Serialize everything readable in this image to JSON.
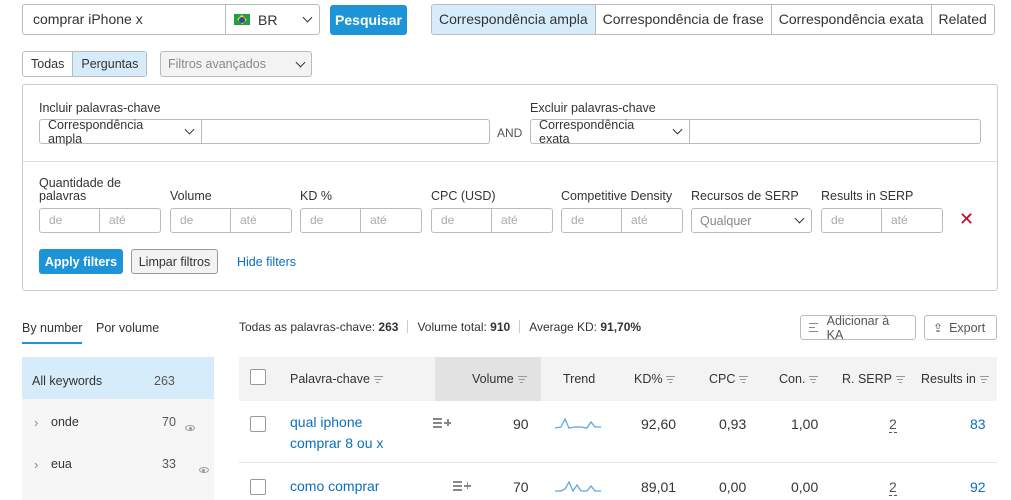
{
  "search": {
    "query": "comprar iPhone x",
    "database": "BR",
    "button": "Pesquisar"
  },
  "match_tabs": [
    "Correspondência ampla",
    "Correspondência de frase",
    "Correspondência exata",
    "Related"
  ],
  "question_tabs": {
    "all": "Todas",
    "questions": "Perguntas",
    "advanced": "Filtros avançados"
  },
  "filters": {
    "include_label": "Incluir palavras-chave",
    "include_match": "Correspondência ampla",
    "and_label": "AND",
    "exclude_label": "Excluir palavras-chave",
    "exclude_match": "Correspondência exata",
    "word_count_label_1": "Quantidade de",
    "word_count_label_2": "palavras",
    "volume_label": "Volume",
    "kd_label": "KD %",
    "cpc_label": "CPC (USD)",
    "density_label": "Competitive Density",
    "serp_features_label": "Recursos de SERP",
    "results_label": "Results in SERP",
    "from_ph": "de",
    "to_ph": "até",
    "serp_any": "Qualquer",
    "apply": "Apply filters",
    "clear": "Limpar filtros",
    "hide": "Hide filters"
  },
  "sort_tabs": {
    "by_number": "By number",
    "by_volume": "Por volume"
  },
  "summary": {
    "all_label": "Todas as palavras-chave:",
    "all_value": "263",
    "volume_label": "Volume total:",
    "volume_value": "910",
    "kd_label": "Average KD:",
    "kd_value": "91,70%"
  },
  "actions": {
    "add_ka": "Adicionar à KA",
    "export": "Export"
  },
  "groups": [
    {
      "label": "All keywords",
      "count": "263"
    },
    {
      "label": "onde",
      "count": "70"
    },
    {
      "label": "eua",
      "count": "33"
    }
  ],
  "table": {
    "headers": {
      "keyword": "Palavra-chave",
      "volume": "Volume",
      "trend": "Trend",
      "kd": "KD%",
      "cpc": "CPC",
      "con": "Con.",
      "serp": "R. SERP",
      "results": "Results in"
    },
    "rows": [
      {
        "keyword_1": "qual iphone",
        "keyword_2": "comprar 8 ou x",
        "volume": "90",
        "kd": "92,60",
        "cpc": "0,93",
        "con": "1,00",
        "serp": "2",
        "results": "83"
      },
      {
        "keyword_1": "como comprar",
        "keyword_2": "",
        "volume": "70",
        "kd": "89,01",
        "cpc": "0,00",
        "con": "0,00",
        "serp": "2",
        "results": "92"
      }
    ]
  },
  "colors": {
    "accent": "#1d94d7",
    "active_tab_bg": "#d7ecfa",
    "link": "#0a6ebd",
    "danger": "#d0021b"
  }
}
